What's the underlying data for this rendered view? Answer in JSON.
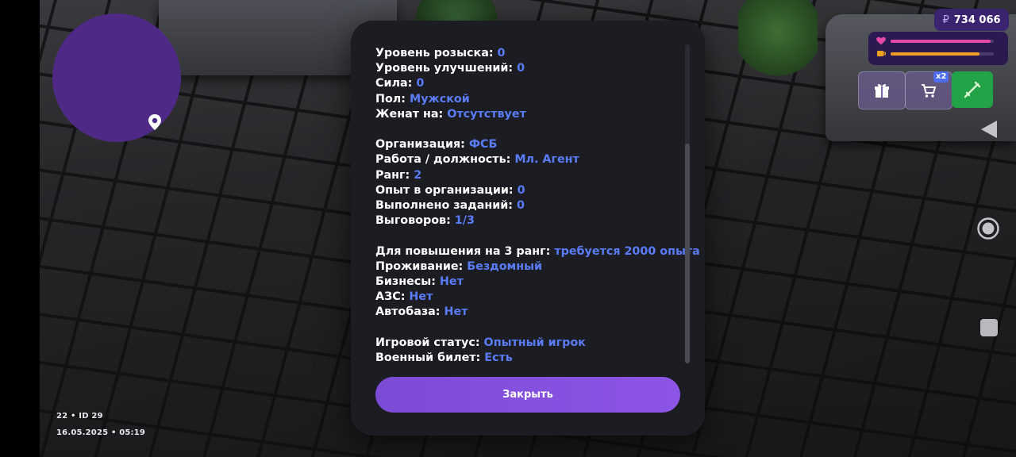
{
  "hud": {
    "id_line": "22 • ID 29",
    "datetime": "16.05.2025 • 05:19",
    "money_currency": "₽",
    "money_value": "734 066",
    "hp_fraction": 0.97,
    "food_fraction": 0.86,
    "x2_badge": "x2"
  },
  "colors": {
    "accent": "#8a52e0",
    "value_blue": "#5b7cf7",
    "hp_pink": "#e64aa8",
    "food_orange": "#f0a020",
    "minimap_purple": "#4e2a86",
    "green_button": "#23a347"
  },
  "icons": [
    "map-pin-icon",
    "heart-icon",
    "food-icon",
    "gift-icon",
    "cart-icon",
    "weapon-icon",
    "back-icon",
    "home-icon",
    "recent-apps-icon"
  ],
  "modal": {
    "lines": [
      {
        "label": "Уровень розыска:",
        "value": "0"
      },
      {
        "label": "Уровень улучшений:",
        "value": "0"
      },
      {
        "label": "Сила:",
        "value": "0"
      },
      {
        "label": "Пол:",
        "value": "Мужской"
      },
      {
        "label": "Женат на:",
        "value": "Отсутствует"
      },
      {
        "label": "Организация:",
        "value": "ФСБ"
      },
      {
        "label": "Работа / должность:",
        "value": "Мл. Агент"
      },
      {
        "label": "Ранг:",
        "value": "2"
      },
      {
        "label": "Опыт в организации:",
        "value": "0"
      },
      {
        "label": "Выполнено заданий:",
        "value": "0"
      },
      {
        "label": "Выговоров:",
        "value": "1/3"
      },
      {
        "label": "Для повышения на 3 ранг:",
        "value": "требуется 2000 опыта"
      },
      {
        "label": "Проживание:",
        "value": "Бездомный"
      },
      {
        "label": "Бизнесы:",
        "value": "Нет"
      },
      {
        "label": "АЗС:",
        "value": "Нет"
      },
      {
        "label": "Автобаза:",
        "value": "Нет"
      },
      {
        "label": "Игровой статус:",
        "value": "Опытный игрок"
      },
      {
        "label": "Военный билет:",
        "value": "Есть"
      }
    ],
    "close_label": "Закрыть"
  }
}
